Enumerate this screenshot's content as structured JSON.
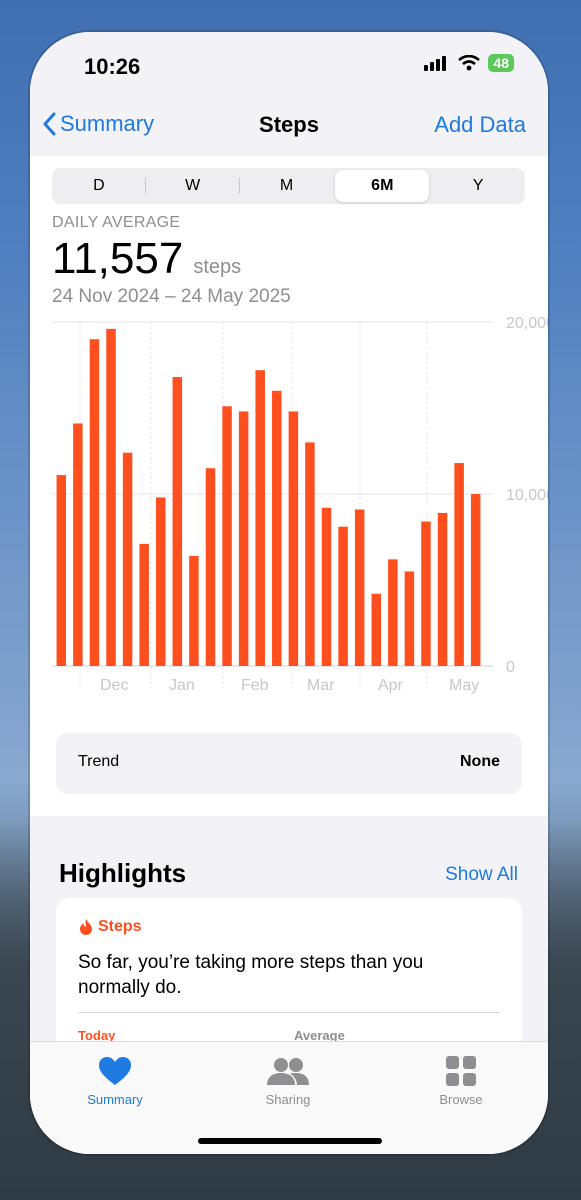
{
  "status_bar": {
    "time": "10:26",
    "battery": "48"
  },
  "nav": {
    "back_label": "Summary",
    "title": "Steps",
    "action_label": "Add Data"
  },
  "segments": [
    "D",
    "W",
    "M",
    "6M",
    "Y"
  ],
  "selected_segment": "6M",
  "summary": {
    "range_label": "DAILY AVERAGE",
    "value": "11,557",
    "unit": "steps",
    "date_range": "24 Nov 2024 – 24 May 2025"
  },
  "chart_data": {
    "type": "bar",
    "color": "#ff4f1f",
    "ylim": [
      0,
      20000
    ],
    "y_ticks": [
      "0",
      "10,000",
      "20,000"
    ],
    "x_tick_labels": [
      "Dec",
      "Jan",
      "Feb",
      "Mar",
      "Apr",
      "May"
    ],
    "values": [
      11100,
      14100,
      19000,
      19600,
      12400,
      7100,
      9800,
      16800,
      6400,
      11500,
      15100,
      14800,
      17200,
      16000,
      14800,
      13000,
      9200,
      8100,
      9100,
      4200,
      6200,
      5500,
      8400,
      8900,
      11800,
      10000
    ]
  },
  "trend": {
    "label": "Trend",
    "value": "None"
  },
  "highlights": {
    "title": "Highlights",
    "show_all": "Show All",
    "card_title": "Steps",
    "card_text": "So far, you’re taking more steps than you normally do.",
    "left_label": "Today",
    "right_label": "Average"
  },
  "tabs": [
    {
      "label": "Summary",
      "icon": "heart-icon"
    },
    {
      "label": "Sharing",
      "icon": "people-icon"
    },
    {
      "label": "Browse",
      "icon": "grid-icon"
    }
  ]
}
